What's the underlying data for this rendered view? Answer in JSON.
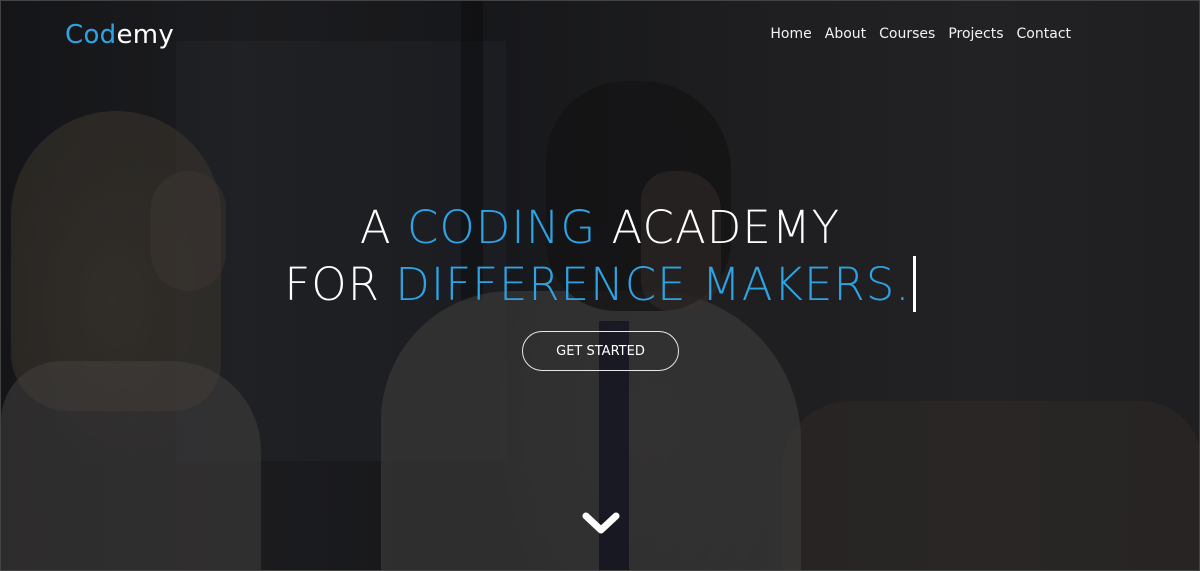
{
  "brand": {
    "logo_part1": "Co",
    "logo_part2": "d",
    "logo_part3": "emy",
    "accent_color": "#2ea3e3"
  },
  "nav": {
    "items": [
      {
        "label": "Home"
      },
      {
        "label": "About"
      },
      {
        "label": "Courses"
      },
      {
        "label": "Projects"
      },
      {
        "label": "Contact"
      }
    ]
  },
  "hero": {
    "line1_a": "A ",
    "line1_b": "CODING",
    "line1_c": " ACADEMY",
    "line2_a": "FOR ",
    "line2_b": "DIFFERENCE MAKERS.",
    "cta_label": "GET STARTED",
    "scroll_icon": "chevron-down-icon"
  }
}
